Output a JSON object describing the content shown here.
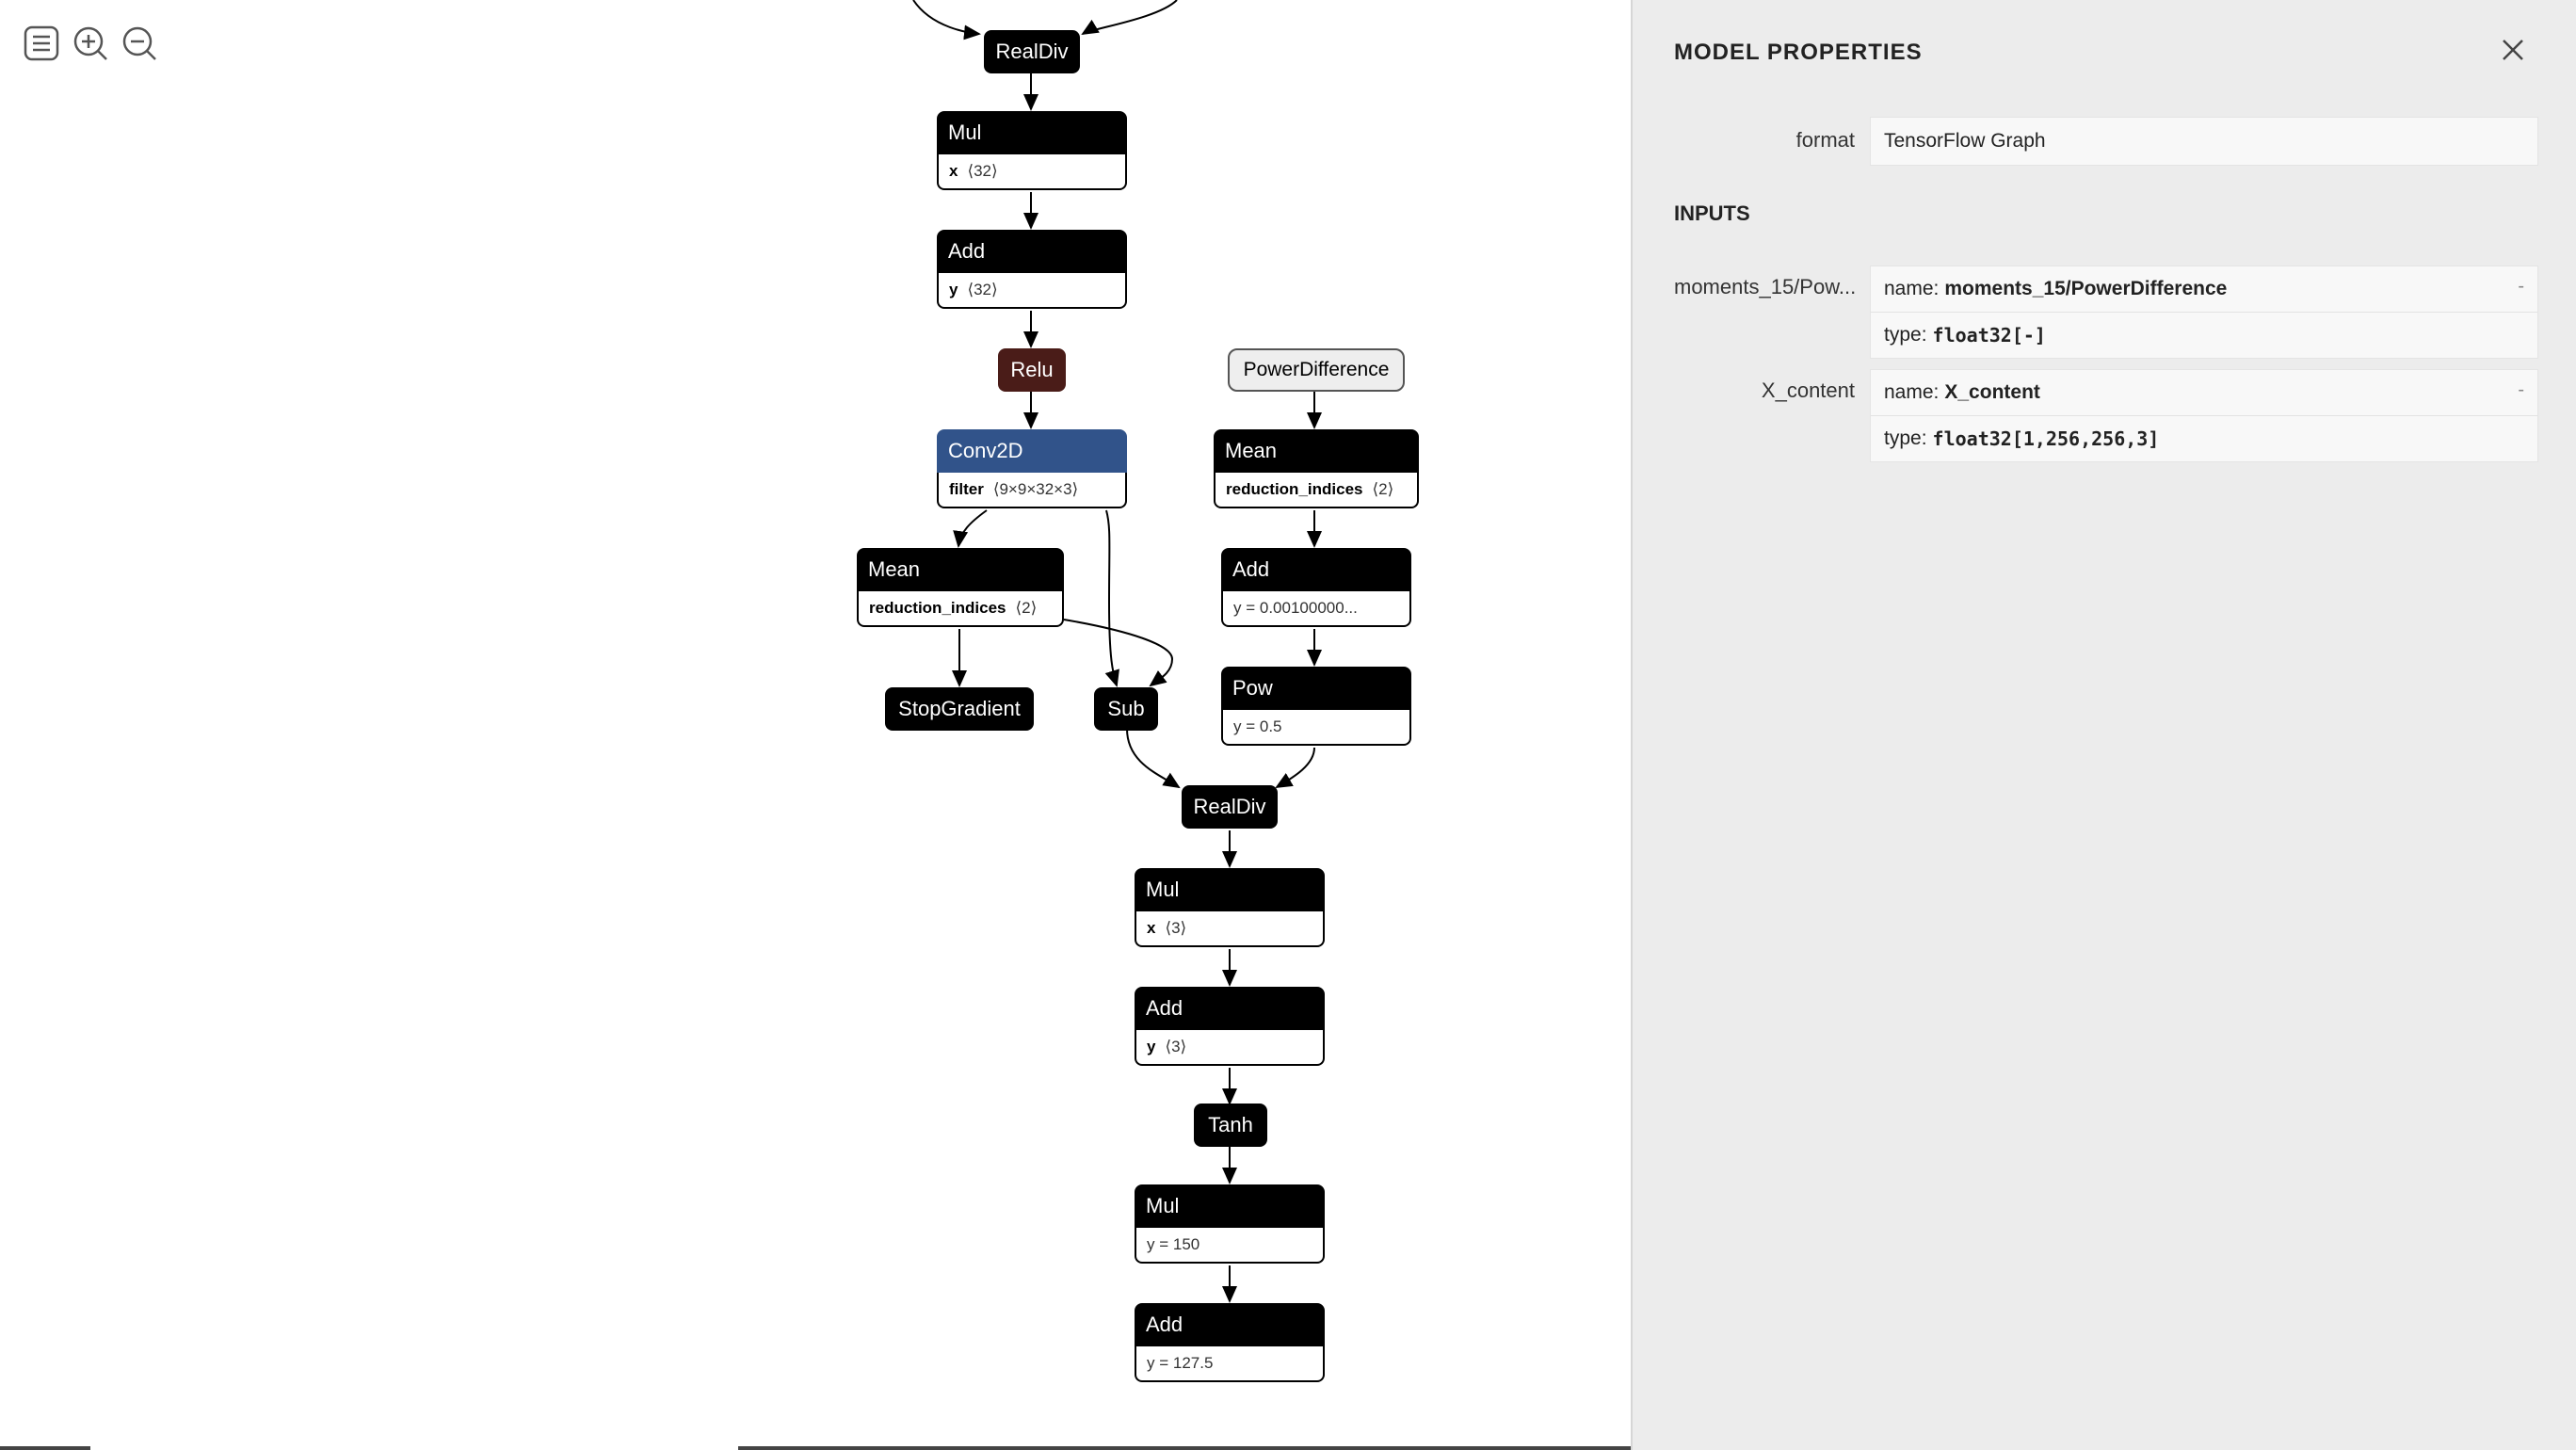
{
  "toolbar": {
    "icons": [
      "sidebar-icon",
      "zoom-in-icon",
      "zoom-out-icon"
    ]
  },
  "graph": {
    "n_realdiv_top": "RealDiv",
    "n_mul1": {
      "title": "Mul",
      "attr": "x",
      "val": "⟨32⟩"
    },
    "n_add1": {
      "title": "Add",
      "attr": "y",
      "val": "⟨32⟩"
    },
    "n_relu": "Relu",
    "n_conv": {
      "title": "Conv2D",
      "attr": "filter",
      "val": "⟨9×9×32×3⟩"
    },
    "n_mean_left": {
      "title": "Mean",
      "attr": "reduction_indices",
      "val": "⟨2⟩"
    },
    "n_stopgrad": "StopGradient",
    "n_sub": "Sub",
    "n_powdiff": "PowerDifference",
    "n_mean_right": {
      "title": "Mean",
      "attr": "reduction_indices",
      "val": "⟨2⟩"
    },
    "n_add_eps": {
      "title": "Add",
      "val": "y = 0.00100000..."
    },
    "n_pow": {
      "title": "Pow",
      "val": "y = 0.5"
    },
    "n_realdiv2": "RealDiv",
    "n_mul2": {
      "title": "Mul",
      "attr": "x",
      "val": "⟨3⟩"
    },
    "n_add2": {
      "title": "Add",
      "attr": "y",
      "val": "⟨3⟩"
    },
    "n_tanh": "Tanh",
    "n_mul3": {
      "title": "Mul",
      "val": "y = 150"
    },
    "n_add3": {
      "title": "Add",
      "val": "y = 127.5"
    }
  },
  "panel": {
    "title": "MODEL PROPERTIES",
    "format_label": "format",
    "format_value": "TensorFlow Graph",
    "inputs_heading": "INPUTS",
    "inputs": [
      {
        "label": "moments_15/Pow...",
        "name_key": "name:",
        "name": "moments_15/PowerDifference",
        "type_key": "type:",
        "type": "float32[-]",
        "expander": "-"
      },
      {
        "label": "X_content",
        "name_key": "name:",
        "name": "X_content",
        "type_key": "type:",
        "type": "float32[1,256,256,3]",
        "expander": "-"
      }
    ]
  }
}
